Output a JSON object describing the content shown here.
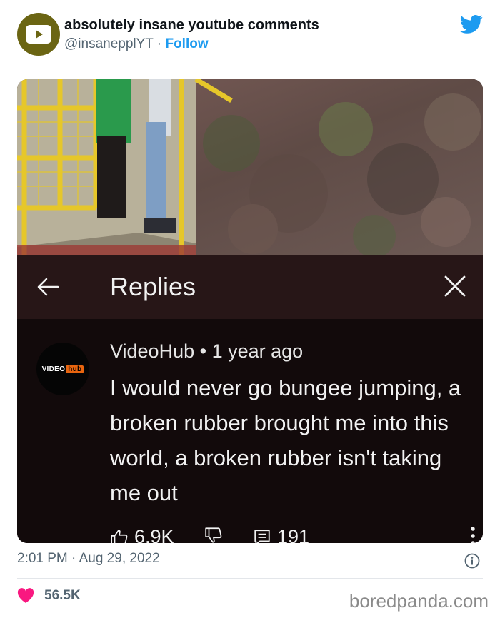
{
  "tweet": {
    "display_name": "absolutely insane youtube comments",
    "handle": "@insanepplYT",
    "separator": "·",
    "follow_label": "Follow",
    "timestamp": "2:01 PM · Aug 29, 2022",
    "likes": "56.5K"
  },
  "youtube": {
    "panel_title": "Replies",
    "comment": {
      "author": "VideoHub",
      "bullet": "•",
      "age": "1 year ago",
      "avatar_text": "VIDEO",
      "avatar_badge": "hub",
      "text": "I would never go bungee jumping, a broken rubber brought me into this world, a broken rubber isn't taking me out",
      "likes": "6.9K",
      "replies": "191"
    }
  },
  "watermark": "boredpanda.com",
  "colors": {
    "link_blue": "#1d9bf0",
    "avatar_olive": "#6b6513",
    "like_heart": "#f91880",
    "replies_bar": "#271617",
    "comment_bg": "#120a0b"
  },
  "icons": [
    "youtube-play-icon",
    "twitter-bird-icon",
    "back-arrow-icon",
    "close-icon",
    "thumbs-up-icon",
    "thumbs-down-icon",
    "reply-icon",
    "more-vertical-icon",
    "info-icon",
    "heart-icon"
  ]
}
